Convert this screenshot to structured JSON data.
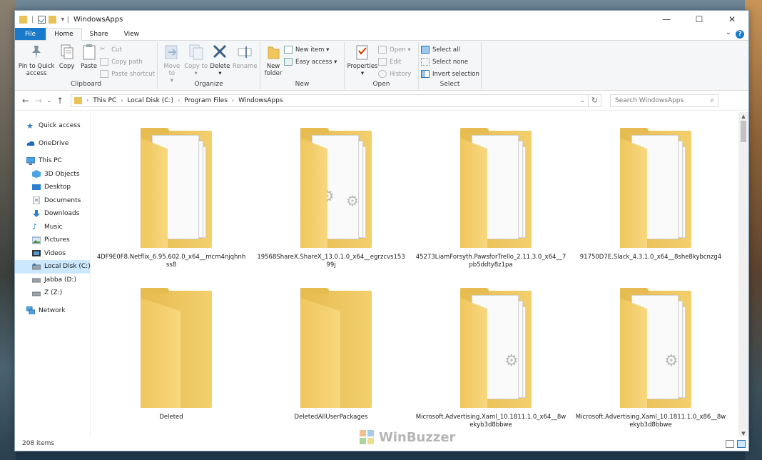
{
  "window": {
    "title": "WindowsApps"
  },
  "tabs": [
    "File",
    "Home",
    "Share",
    "View"
  ],
  "ribbon": {
    "clipboard": {
      "label": "Clipboard",
      "pin": "Pin to Quick access",
      "copy": "Copy",
      "paste": "Paste",
      "cut": "Cut",
      "copy_path": "Copy path",
      "paste_shortcut": "Paste shortcut"
    },
    "organize": {
      "label": "Organize",
      "move_to": "Move to",
      "copy_to": "Copy to",
      "delete": "Delete",
      "rename": "Rename"
    },
    "new": {
      "label": "New",
      "new_folder": "New folder",
      "new_item": "New item",
      "easy_access": "Easy access"
    },
    "open": {
      "label": "Open",
      "properties": "Properties",
      "open": "Open",
      "edit": "Edit",
      "history": "History"
    },
    "select": {
      "label": "Select",
      "select_all": "Select all",
      "select_none": "Select none",
      "invert": "Invert selection"
    }
  },
  "address": {
    "crumbs": [
      "This PC",
      "Local Disk (C:)",
      "Program Files",
      "WindowsApps"
    ]
  },
  "search": {
    "placeholder": "Search WindowsApps"
  },
  "nav": {
    "quick_access": "Quick access",
    "onedrive": "OneDrive",
    "this_pc": "This PC",
    "objects3d": "3D Objects",
    "desktop": "Desktop",
    "documents": "Documents",
    "downloads": "Downloads",
    "music": "Music",
    "pictures": "Pictures",
    "videos": "Videos",
    "local_disk": "Local Disk (C:)",
    "jabba": "Jabba (D:)",
    "z": "Z (Z:)",
    "network": "Network"
  },
  "items": [
    {
      "name": "4DF9E0F8.Netflix_6.95.602.0_x64__mcm4njqhnhss8",
      "type": "docs"
    },
    {
      "name": "19568ShareX.ShareX_13.0.1.0_x64__egrzcvs15399j",
      "type": "gears"
    },
    {
      "name": "45273LiamForsyth.PawsforTrello_2.11.3.0_x64__7pb5ddty8z1pa",
      "type": "docs"
    },
    {
      "name": "91750D7E.Slack_4.3.1.0_x64__8she8kybcnzg4",
      "type": "docs"
    },
    {
      "name": "Deleted",
      "type": "empty"
    },
    {
      "name": "DeletedAllUserPackages",
      "type": "empty"
    },
    {
      "name": "Microsoft.Advertising.Xaml_10.1811.1.0_x64__8wekyb3d8bbwe",
      "type": "gearsmall"
    },
    {
      "name": "Microsoft.Advertising.Xaml_10.1811.1.0_x86__8wekyb3d8bbwe",
      "type": "gearsmall"
    }
  ],
  "status": {
    "count": "208 items"
  },
  "watermark": {
    "text": "WinBuzzer"
  }
}
